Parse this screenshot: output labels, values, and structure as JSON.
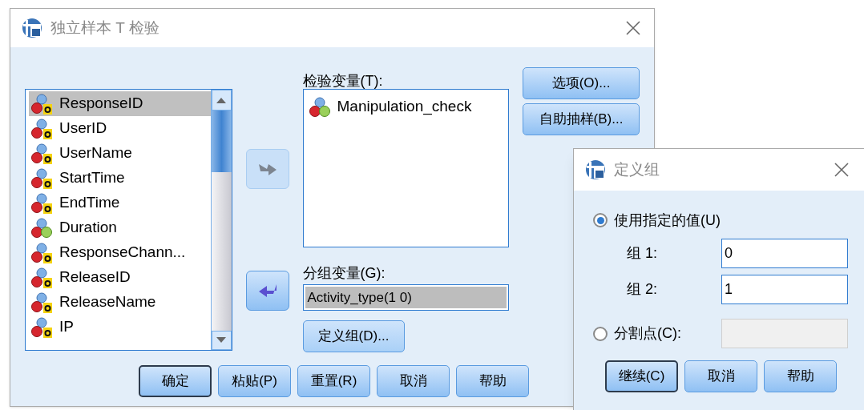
{
  "main_dialog": {
    "title": "独立样本 T 检验",
    "variables": [
      {
        "name": "ResponseID",
        "kind": "string",
        "selected": true
      },
      {
        "name": "UserID",
        "kind": "string",
        "selected": false
      },
      {
        "name": "UserName",
        "kind": "string",
        "selected": false
      },
      {
        "name": "StartTime",
        "kind": "string",
        "selected": false
      },
      {
        "name": "EndTime",
        "kind": "string",
        "selected": false
      },
      {
        "name": "Duration",
        "kind": "scale",
        "selected": false
      },
      {
        "name": "ResponseChann...",
        "kind": "string",
        "selected": false
      },
      {
        "name": "ReleaseID",
        "kind": "string",
        "selected": false
      },
      {
        "name": "ReleaseName",
        "kind": "string",
        "selected": false
      },
      {
        "name": "IP",
        "kind": "string",
        "selected": false
      }
    ],
    "move_to_test_button": {
      "disabled": true
    },
    "move_back_button": {
      "disabled": false
    },
    "test_variables_label": "检验变量(T):",
    "test_variables": [
      {
        "name": "Manipulation_check",
        "kind": "scale"
      }
    ],
    "grouping_variable_label": "分组变量(G):",
    "grouping_variable": "Activity_type(1 0)",
    "define_groups_button": "定义组(D)...",
    "side_buttons": [
      "选项(O)...",
      "自助抽样(B)..."
    ],
    "buttons": [
      {
        "label": "确定",
        "default": true
      },
      {
        "label": "粘贴(P)",
        "default": false
      },
      {
        "label": "重置(R)",
        "default": false
      },
      {
        "label": "取消",
        "default": false
      },
      {
        "label": "帮助",
        "default": false
      }
    ]
  },
  "define_groups_dialog": {
    "title": "定义组",
    "options": [
      {
        "label": "使用指定的值(U)",
        "selected": true
      },
      {
        "label": "分割点(C):",
        "selected": false
      }
    ],
    "group_fields": [
      {
        "label": "组 1:",
        "value": "0"
      },
      {
        "label": "组 2:",
        "value": "1"
      }
    ],
    "cut_point_field": {
      "disabled": true
    },
    "buttons": [
      {
        "label": "继续(C)",
        "default": true
      },
      {
        "label": "取消",
        "default": false
      },
      {
        "label": "帮助",
        "default": false
      }
    ]
  }
}
